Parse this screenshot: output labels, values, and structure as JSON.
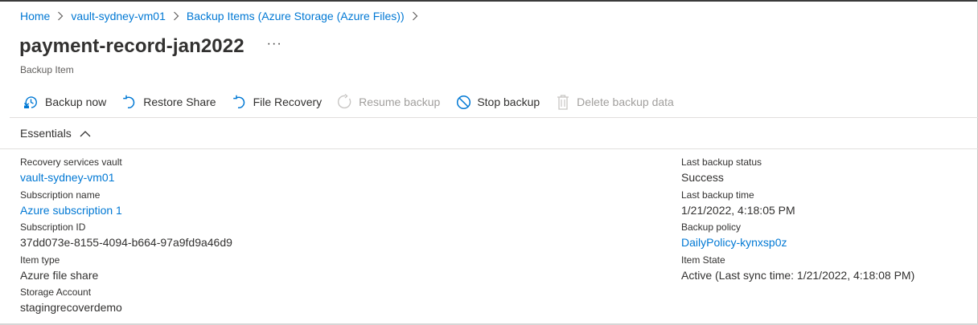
{
  "breadcrumb": {
    "items": [
      {
        "label": "Home"
      },
      {
        "label": "vault-sydney-vm01"
      },
      {
        "label": "Backup Items (Azure Storage (Azure Files))"
      }
    ]
  },
  "header": {
    "title": "payment-record-jan2022",
    "more_label": "···",
    "subtitle": "Backup Item"
  },
  "toolbar": {
    "backup_now": {
      "label": "Backup now",
      "icon": "backup-now-icon"
    },
    "restore_share": {
      "label": "Restore Share",
      "icon": "restore-icon"
    },
    "file_recovery": {
      "label": "File Recovery",
      "icon": "restore-icon"
    },
    "resume_backup": {
      "label": "Resume backup",
      "icon": "refresh-icon"
    },
    "stop_backup": {
      "label": "Stop backup",
      "icon": "stop-icon"
    },
    "delete_backup_data": {
      "label": "Delete backup data",
      "icon": "trash-icon"
    }
  },
  "essentials": {
    "header_label": "Essentials",
    "left": {
      "vault": {
        "label": "Recovery services vault",
        "value": "vault-sydney-vm01"
      },
      "subscription_name": {
        "label": "Subscription name",
        "value": "Azure subscription 1"
      },
      "subscription_id": {
        "label": "Subscription ID",
        "value": "37dd073e-8155-4094-b664-97a9fd9a46d9"
      },
      "item_type": {
        "label": "Item type",
        "value": "Azure file share"
      },
      "storage_account": {
        "label": "Storage Account",
        "value": "stagingrecoverdemo"
      }
    },
    "right": {
      "last_backup_status": {
        "label": "Last backup status",
        "value": "Success"
      },
      "last_backup_time": {
        "label": "Last backup time",
        "value": "1/21/2022, 4:18:05 PM"
      },
      "backup_policy": {
        "label": "Backup policy",
        "value": "DailyPolicy-kynxsp0z"
      },
      "item_state": {
        "label": "Item State",
        "value": "Active (Last sync time: 1/21/2022, 4:18:08 PM)"
      }
    }
  },
  "colors": {
    "accent": "#0078d4",
    "text": "#323130",
    "disabled": "#a19f9d"
  }
}
